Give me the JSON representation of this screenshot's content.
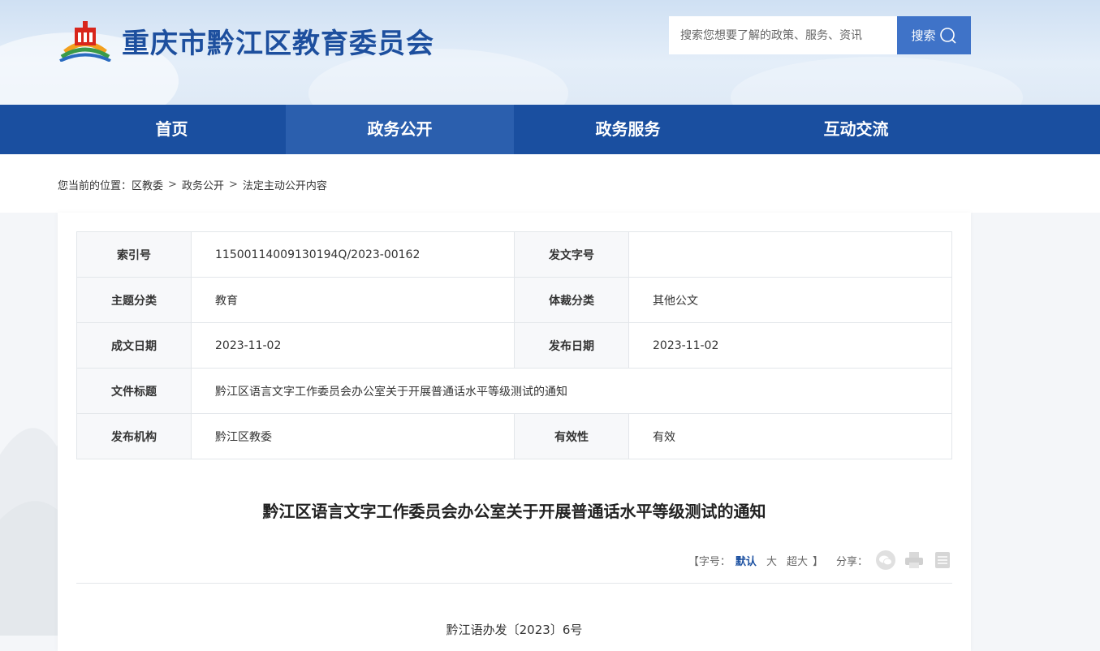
{
  "header": {
    "site_title": "重庆市黔江区教育委员会",
    "search_placeholder": "搜索您想要了解的政策、服务、资讯",
    "search_button": "搜索"
  },
  "nav": {
    "items": [
      {
        "label": "首页",
        "active": false
      },
      {
        "label": "政务公开",
        "active": true
      },
      {
        "label": "政务服务",
        "active": false
      },
      {
        "label": "互动交流",
        "active": false
      }
    ]
  },
  "breadcrumb": {
    "prefix": "您当前的位置：",
    "items": [
      "区教委",
      "政务公开",
      "法定主动公开内容"
    ],
    "separator": ">"
  },
  "meta_table": {
    "rows": [
      {
        "k1": "索引号",
        "v1": "11500114009130194Q/2023-00162",
        "k2": "发文字号",
        "v2": ""
      },
      {
        "k1": "主题分类",
        "v1": "教育",
        "k2": "体裁分类",
        "v2": "其他公文"
      },
      {
        "k1": "成文日期",
        "v1": "2023-11-02",
        "k2": "发布日期",
        "v2": "2023-11-02"
      },
      {
        "k1": "文件标题",
        "v1": "黔江区语言文字工作委员会办公室关于开展普通话水平等级测试的通知"
      },
      {
        "k1": "发布机构",
        "v1": "黔江区教委",
        "k2": "有效性",
        "v2": "有效"
      }
    ]
  },
  "document": {
    "title": "黔江区语言文字工作委员会办公室关于开展普通话水平等级测试的通知",
    "doc_number": "黔江语办发〔2023〕6号"
  },
  "tools": {
    "bracket_open": "【",
    "font_label": "字号：",
    "font_default": "默认",
    "font_large": "大",
    "font_xlarge": "超大",
    "bracket_close": "】",
    "share_label": "分享："
  },
  "colors": {
    "nav_bg": "#1a4fa0",
    "nav_active": "#2b5fae",
    "search_btn": "#3f73c8",
    "title_blue": "#1d4f9e"
  }
}
